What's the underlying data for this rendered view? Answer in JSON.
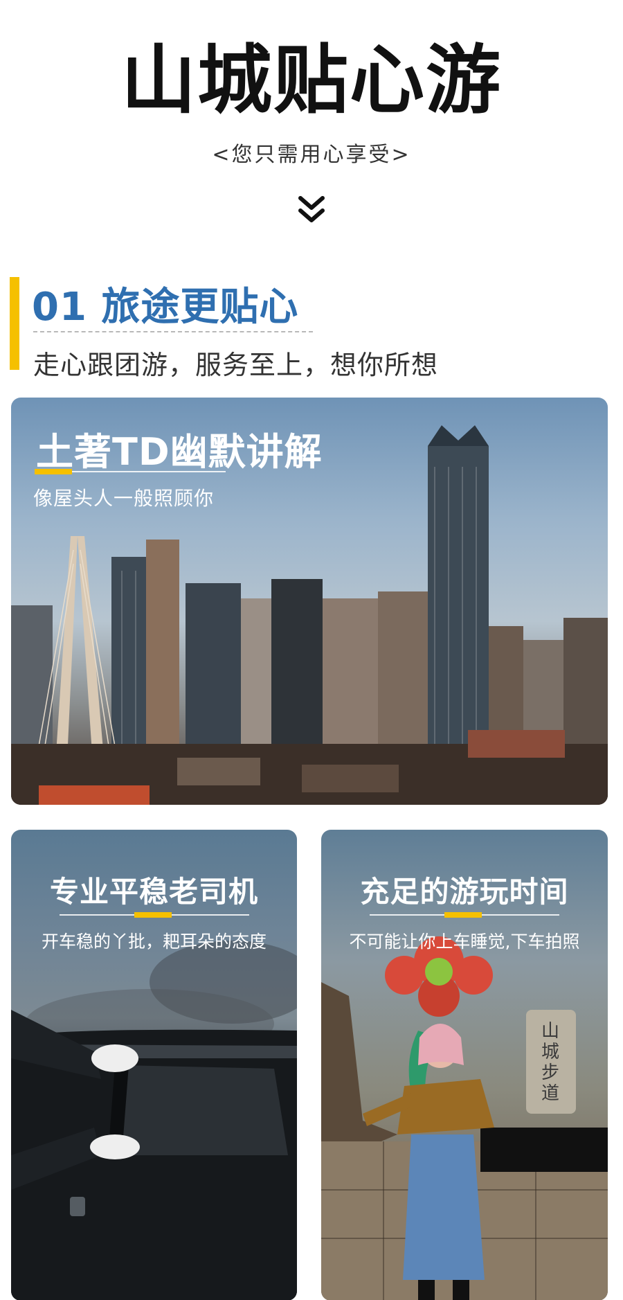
{
  "hero": {
    "title": "山城贴心游",
    "subtitle": "<您只需用心享受>"
  },
  "section": {
    "title": "01 旅途更贴心",
    "description": "走心跟团游，服务至上，想你所想"
  },
  "cards": {
    "city": {
      "title": "土著TD幽默讲解",
      "subtitle": "像屋头人一般照顾你"
    },
    "driver": {
      "title": "专业平稳老司机",
      "subtitle": "开车稳的丫批，耙耳朵的态度"
    },
    "time": {
      "title": "充足的游玩时间",
      "subtitle": "不可能让你上车睡觉,下车拍照",
      "stone_text": "山城步道"
    }
  },
  "icons": {
    "chevron": "double-chevron-down-icon"
  },
  "colors": {
    "accent_yellow": "#f5c000",
    "section_blue": "#2f6fb0"
  }
}
